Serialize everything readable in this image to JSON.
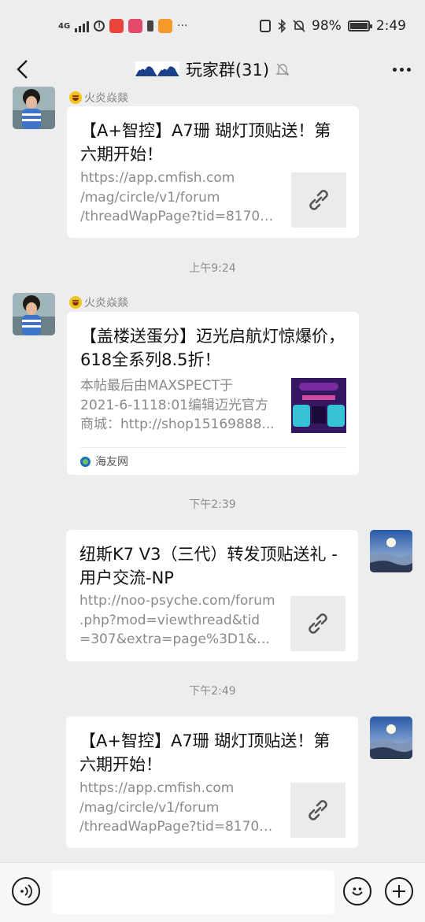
{
  "status_bar": {
    "network": "4G",
    "battery_percent": "98%",
    "time": "2:49",
    "dots": "···"
  },
  "header": {
    "title": "玩家群(31)"
  },
  "messages": [
    {
      "nickname": "火炎焱燚",
      "title": "【A+智控】A7珊 瑚灯顶贴送！第六期开始！",
      "desc_lines": [
        "https://app.cmfish.com",
        "/mag/circle/v1/forum",
        "/threadWapPage?tid=81709..."
      ]
    },
    {
      "timestamp": "上午9:24",
      "nickname": "火炎焱燚",
      "title": "【盖楼送蛋分】迈光启航灯惊爆价，618全系列8.5折！",
      "desc_lines": [
        "本帖最后由MAXSPECT于",
        "2021-6-1118:01编辑迈光官方",
        "商城：http://shop15169888..."
      ],
      "source": "海友网"
    },
    {
      "timestamp": "下午2:39",
      "title": "纽斯K7 V3（三代）转发顶贴送礼 - 用户交流-NP",
      "desc_lines": [
        "http://noo-psyche.com/forum",
        ".php?mod=viewthread&tid",
        "=307&extra=page%3D1&mo..."
      ]
    },
    {
      "timestamp": "下午2:49",
      "title": "【A+智控】A7珊 瑚灯顶贴送！第六期开始！",
      "desc_lines": [
        "https://app.cmfish.com",
        "/mag/circle/v1/forum",
        "/threadWapPage?tid=81709..."
      ]
    }
  ],
  "input": {
    "placeholder": ""
  }
}
